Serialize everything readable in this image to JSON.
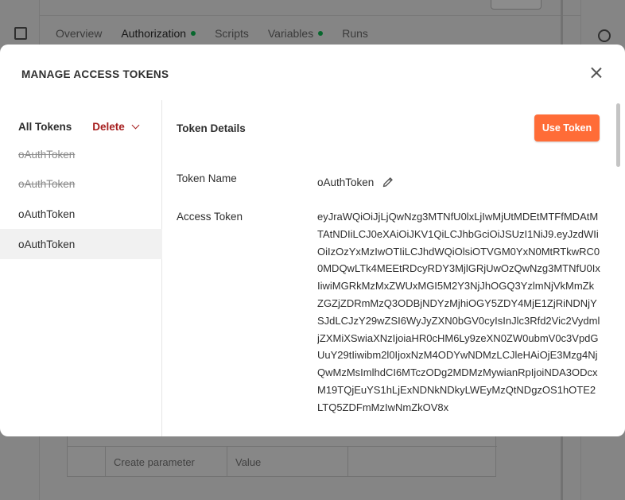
{
  "background": {
    "tabs": [
      {
        "label": "Overview",
        "dot": false
      },
      {
        "label": "Authorization",
        "dot": true
      },
      {
        "label": "Scripts",
        "dot": false
      },
      {
        "label": "Variables",
        "dot": true
      },
      {
        "label": "Runs",
        "dot": false
      }
    ],
    "params_table": {
      "key_placeholder": "Create parameter",
      "value_placeholder": "Value"
    },
    "icons": [
      "document-icon",
      "history-icon"
    ],
    "dot_color": "#0cbb52"
  },
  "modal": {
    "title": "MANAGE ACCESS TOKENS",
    "close_icon": "close-icon",
    "list": {
      "header_label": "All Tokens",
      "delete_label": "Delete",
      "tokens": [
        {
          "name": "oAuthToken",
          "expired": true,
          "selected": false
        },
        {
          "name": "oAuthToken",
          "expired": true,
          "selected": false
        },
        {
          "name": "oAuthToken",
          "expired": false,
          "selected": false
        },
        {
          "name": "oAuthToken",
          "expired": false,
          "selected": true
        }
      ]
    },
    "details": {
      "heading": "Token Details",
      "use_token_label": "Use Token",
      "token_name_label": "Token Name",
      "token_name_value": "oAuthToken",
      "access_token_label": "Access Token",
      "access_token_value": "eyJraWQiOiJjLjQwNzg3MTNfU0lxLjIwMjUtMDEtMTFfMDAtMTAtNDIiLCJ0eXAiOiJKV1QiLCJhbGciOiJSUzI1NiJ9.eyJzdWIiOiIzOzYxMzIwOTIiLCJhdWQiOlsiOTVGM0YxN0MtRTkwRC00MDQwLTk4MEEtRDcyRDY3MjlGRjUwOzQwNzg3MTNfU0IxIiwiMGRkMzMxZWUxMGI5M2Y3NjJhOGQ3YzlmNjVkMmZkZGZjZDRmMzQ3ODBjNDYzMjhiOGY5ZDY4MjE1ZjRiNDNjYSJdLCJzY29wZSI6WyJyZXN0bGV0cyIsInJlc3Rfd2Vic2VydmljZXMiXSwiaXNzIjoiaHR0cHM6Ly9zeXN0ZW0ubmV0c3VpdGUuY29tIiwibm2l0IjoxNzM4ODYwNDMzLCJleHAiOjE3Mzg4NjQwMzMsImlhdCI6MTczODg2MDMzMywianRpIjoiNDA3ODcxM19TQjEuYS1hLjExNDNkNDkyLWEyMzQtNDgzOS1hOTE2LTQ5ZDFmMzIwNmZkOV8x"
    },
    "accent_color": "#ff6c37",
    "delete_color": "#a61e1e"
  }
}
